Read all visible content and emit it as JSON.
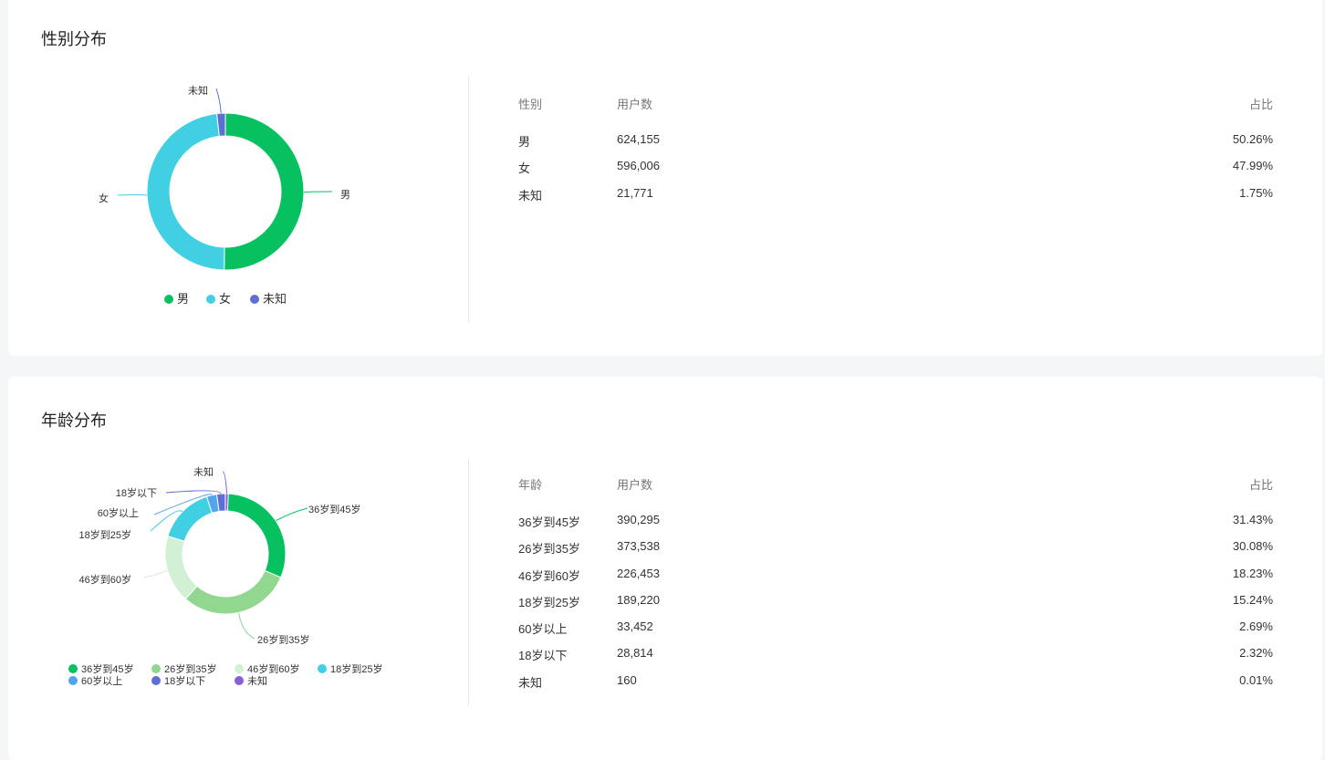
{
  "gender": {
    "title": "性别分布",
    "table": {
      "headers": [
        "性别",
        "用户数",
        "占比"
      ],
      "rows": [
        [
          "男",
          "624,155",
          "50.26%"
        ],
        [
          "女",
          "596,006",
          "47.99%"
        ],
        [
          "未知",
          "21,771",
          "1.75%"
        ]
      ]
    }
  },
  "age": {
    "title": "年龄分布",
    "table": {
      "headers": [
        "年龄",
        "用户数",
        "占比"
      ],
      "rows": [
        [
          "36岁到45岁",
          "390,295",
          "31.43%"
        ],
        [
          "26岁到35岁",
          "373,538",
          "30.08%"
        ],
        [
          "46岁到60岁",
          "226,453",
          "18.23%"
        ],
        [
          "18岁到25岁",
          "189,220",
          "15.24%"
        ],
        [
          "60岁以上",
          "33,452",
          "2.69%"
        ],
        [
          "18岁以下",
          "28,814",
          "2.32%"
        ],
        [
          "未知",
          "160",
          "0.01%"
        ]
      ]
    }
  },
  "chart_data": [
    {
      "type": "pie",
      "title": "性别分布",
      "categories": [
        "男",
        "女",
        "未知"
      ],
      "values": [
        624155,
        596006,
        21771
      ],
      "colors": [
        "#07c160",
        "#40cfe3",
        "#5d6fd1"
      ],
      "legend": "bottom"
    },
    {
      "type": "pie",
      "title": "年龄分布",
      "categories": [
        "36岁到45岁",
        "26岁到35岁",
        "46岁到60岁",
        "18岁到25岁",
        "60岁以上",
        "18岁以下",
        "未知"
      ],
      "values": [
        390295,
        373538,
        226453,
        189220,
        33452,
        28814,
        160
      ],
      "colors": [
        "#07c160",
        "#91d78f",
        "#d2f0d4",
        "#40cfe3",
        "#52a4ec",
        "#5d6fd1",
        "#8a5ed4"
      ],
      "legend": "bottom"
    }
  ]
}
